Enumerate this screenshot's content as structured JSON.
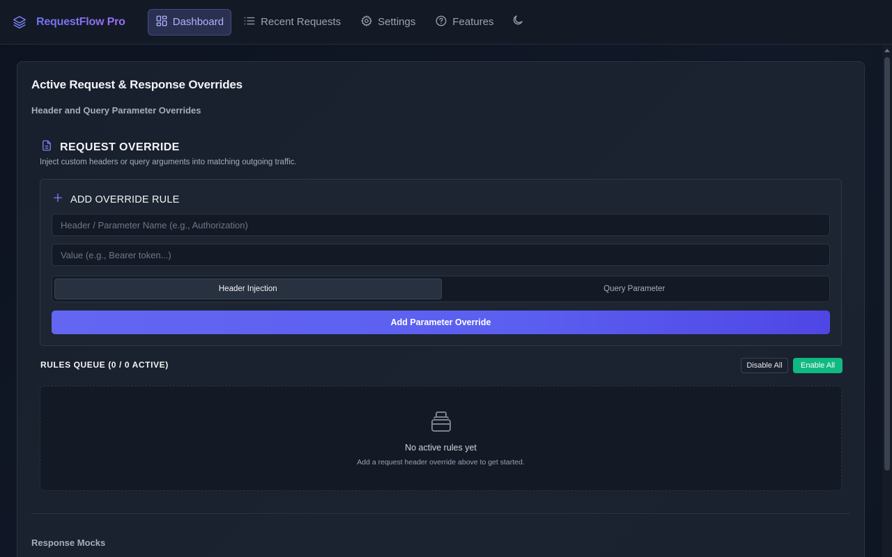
{
  "app": {
    "name": "RequestFlow Pro",
    "logo_icon": "layers-icon"
  },
  "nav": {
    "items": [
      {
        "label": "Dashboard",
        "icon": "dashboard-icon",
        "active": true
      },
      {
        "label": "Recent Requests",
        "icon": "list-icon",
        "active": false
      },
      {
        "label": "Settings",
        "icon": "gear-icon",
        "active": false
      },
      {
        "label": "Features",
        "icon": "help-circle-icon",
        "active": false
      }
    ],
    "theme_toggle_icon": "moon-icon"
  },
  "main": {
    "title": "Active Request & Response Overrides",
    "section_subtitle": "Header and Query Parameter Overrides",
    "request_override": {
      "title": "REQUEST OVERRIDE",
      "description": "Inject custom headers or query arguments into matching outgoing traffic.",
      "icon": "document-icon"
    },
    "add_rule": {
      "title": "ADD OVERRIDE RULE",
      "icon": "plus-icon",
      "name_placeholder": "Header / Parameter Name (e.g., Authorization)",
      "name_value": "",
      "value_placeholder": "Value (e.g., Bearer token...)",
      "value_value": "",
      "mode_options": [
        "Header Injection",
        "Query Parameter"
      ],
      "selected_mode": "Header Injection",
      "submit_label": "Add Parameter Override"
    },
    "queue": {
      "title": "RULES QUEUE (0 / 0 ACTIVE)",
      "disable_all_label": "Disable All",
      "enable_all_label": "Enable All",
      "empty_title": "No active rules yet",
      "empty_subtitle": "Add a request header override above to get started.",
      "empty_icon": "inbox-icon"
    },
    "response_mocks_title": "Response Mocks"
  },
  "colors": {
    "accent": "#6366f1",
    "success": "#10b981",
    "background": "#111827"
  }
}
